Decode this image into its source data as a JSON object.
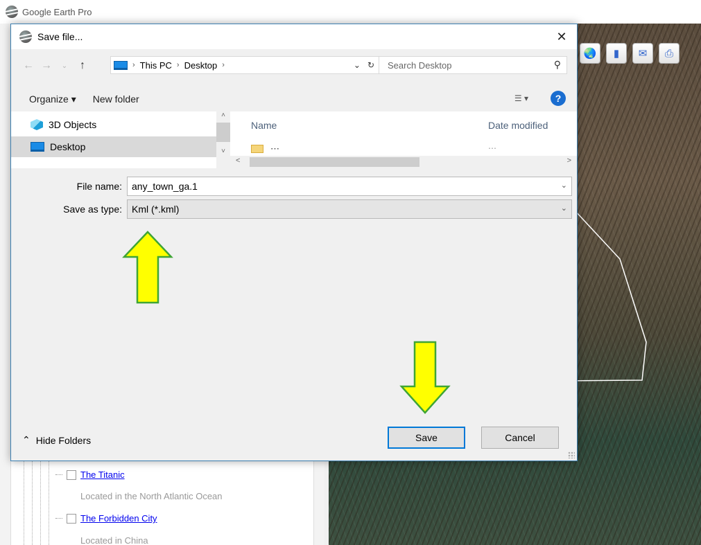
{
  "app": {
    "title": "Google Earth Pro",
    "places": [
      {
        "name": "The Titanic",
        "description": "Located in the North Atlantic Ocean"
      },
      {
        "name": "The Forbidden City",
        "description": "Located in China"
      }
    ],
    "toolbar_icons": [
      "planet-icon",
      "ruler-icon",
      "email-icon",
      "print-icon"
    ]
  },
  "dialog": {
    "title": "Save file...",
    "close_label": "✕",
    "breadcrumb": [
      "This PC",
      "Desktop"
    ],
    "search_placeholder": "Search Desktop",
    "organize_label": "Organize ▾",
    "new_folder_label": "New folder",
    "help_label": "?",
    "nav_items": [
      "3D Objects",
      "Desktop"
    ],
    "selected_nav": "Desktop",
    "columns": {
      "name": "Name",
      "date_modified": "Date modified"
    },
    "file_name_label": "File name:",
    "file_name_value": "any_town_ga.1",
    "save_type_label": "Save as type:",
    "save_type_value": "Kml (*.kml)",
    "hide_folders_label": "Hide Folders",
    "save_label": "Save",
    "cancel_label": "Cancel"
  },
  "colors": {
    "accent": "#0078d7",
    "annotation_fill": "#ffff00",
    "annotation_stroke": "#3fa535"
  }
}
